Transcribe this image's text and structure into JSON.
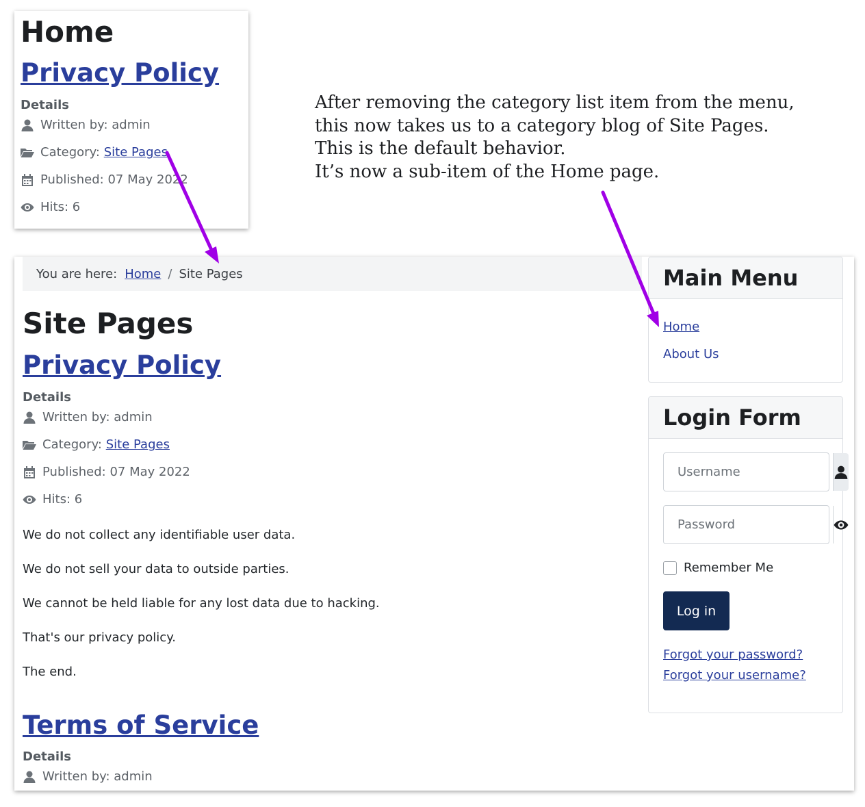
{
  "top_card": {
    "heading": "Home",
    "article_title": "Privacy Policy",
    "details_label": "Details",
    "written_by": "Written by: admin",
    "category_label": "Category:",
    "category_link": "Site Pages",
    "published": "Published: 07 May 2022",
    "hits": "Hits: 6"
  },
  "annotation": {
    "lines": [
      "After removing the category list item from the menu,",
      "this now takes us to a category blog of Site Pages.",
      "This is the default behavior.",
      "It’s now a sub-item of the Home page."
    ],
    "arrow_color": "#a000e6"
  },
  "breadcrumb": {
    "label": "You are here:",
    "home": "Home",
    "separator": "/",
    "current": "Site Pages"
  },
  "main": {
    "page_title": "Site Pages",
    "articles": [
      {
        "title": "Privacy Policy",
        "details_label": "Details",
        "written_by": "Written by: admin",
        "category_label": "Category:",
        "category_link": "Site Pages",
        "published": "Published: 07 May 2022",
        "hits": "Hits: 6",
        "paragraphs": [
          "We do not collect any identifiable user data.",
          "We do not sell your data to outside parties.",
          "We cannot be held liable for any lost data due to hacking.",
          "That's our privacy policy.",
          "The end."
        ]
      },
      {
        "title": "Terms of Service",
        "details_label": "Details",
        "written_by": "Written by: admin"
      }
    ]
  },
  "main_menu": {
    "title": "Main Menu",
    "items": [
      "Home",
      "About Us"
    ]
  },
  "login_form": {
    "title": "Login Form",
    "username_placeholder": "Username",
    "password_placeholder": "Password",
    "remember_me": "Remember Me",
    "login_button": "Log in",
    "forgot_password": "Forgot your password?",
    "forgot_username": "Forgot your username?"
  },
  "colors": {
    "link": "#2a3e9c",
    "button": "#132a52",
    "annotation_arrow": "#a000e6"
  }
}
